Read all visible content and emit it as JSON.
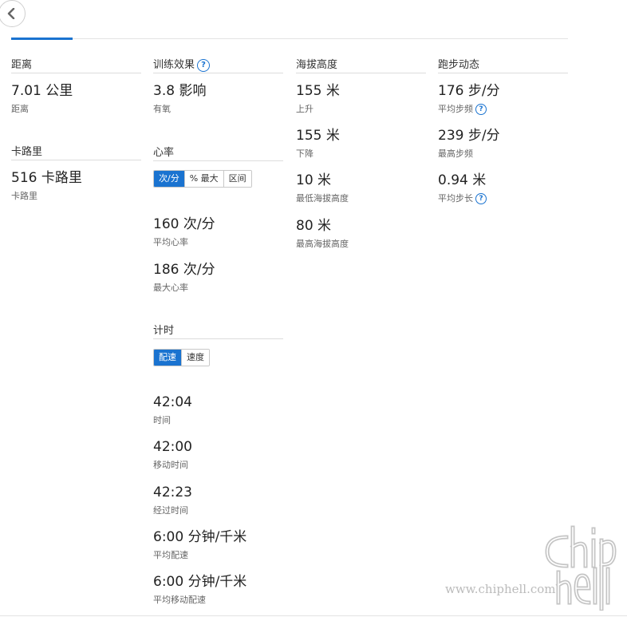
{
  "back_button": {
    "icon": "chevron-left-icon"
  },
  "distance": {
    "heading": "距离",
    "value": "7.01 公里",
    "label": "距离"
  },
  "calories": {
    "heading": "卡路里",
    "value": "516 卡路里",
    "label": "卡路里"
  },
  "training_effect": {
    "heading": "训练效果",
    "value": "3.8 影响",
    "label": "有氧"
  },
  "heart_rate": {
    "heading": "心率",
    "toggle": [
      "次/分",
      "% 最大",
      "区间"
    ],
    "avg_value": "160 次/分",
    "avg_label": "平均心率",
    "max_value": "186 次/分",
    "max_label": "最大心率"
  },
  "timing": {
    "heading": "计时",
    "toggle": [
      "配速",
      "速度"
    ],
    "items": [
      {
        "value": "42:04",
        "label": "时间"
      },
      {
        "value": "42:00",
        "label": "移动时间"
      },
      {
        "value": "42:23",
        "label": "经过时间"
      },
      {
        "value": "6:00 分钟/千米",
        "label": "平均配速"
      },
      {
        "value": "6:00 分钟/千米",
        "label": "平均移动配速"
      }
    ]
  },
  "elevation": {
    "heading": "海拔高度",
    "items": [
      {
        "value": "155 米",
        "label": "上升"
      },
      {
        "value": "155 米",
        "label": "下降"
      },
      {
        "value": "10 米",
        "label": "最低海拔高度"
      },
      {
        "value": "80 米",
        "label": "最高海拔高度"
      }
    ]
  },
  "running_dynamics": {
    "heading": "跑步动态",
    "items": [
      {
        "value": "176 步/分",
        "label": "平均步频"
      },
      {
        "value": "239 步/分",
        "label": "最高步频"
      },
      {
        "value": "0.94 米",
        "label": "平均步长"
      }
    ]
  },
  "help_glyph": "?",
  "watermark": {
    "logo_text": "chip hell",
    "url": "www.chiphell.com"
  },
  "colors": {
    "accent": "#1a73d0",
    "divider": "#dcdcdc",
    "text": "#222222",
    "subtext": "#666666"
  }
}
